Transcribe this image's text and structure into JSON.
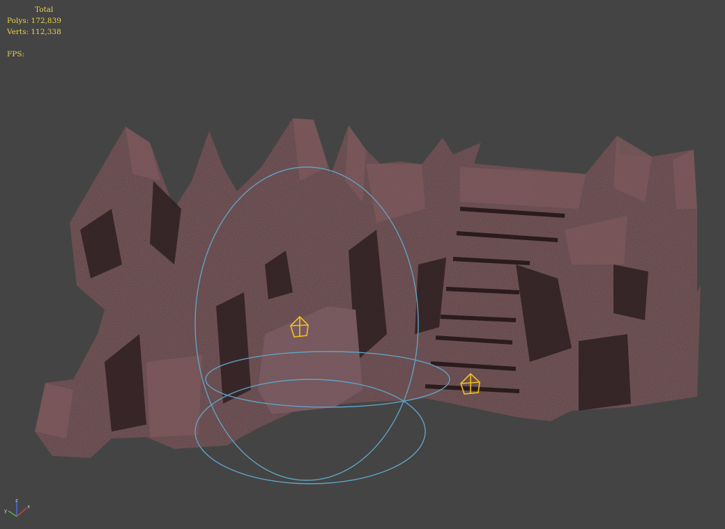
{
  "stats": {
    "title": "Total",
    "polys_label": "Polys:",
    "polys_value": "172,839",
    "verts_label": "Verts:",
    "verts_value": "112,338",
    "fps_label": "FPS:"
  },
  "colors": {
    "background": "#444444",
    "stats_text": "#e8d24a",
    "rock": "#5a3d40",
    "helper_circle": "#5fa3c4",
    "helper_object": "#f2c21c"
  },
  "axis_gizmo": {
    "x": "x",
    "y": "y",
    "z": "z"
  }
}
